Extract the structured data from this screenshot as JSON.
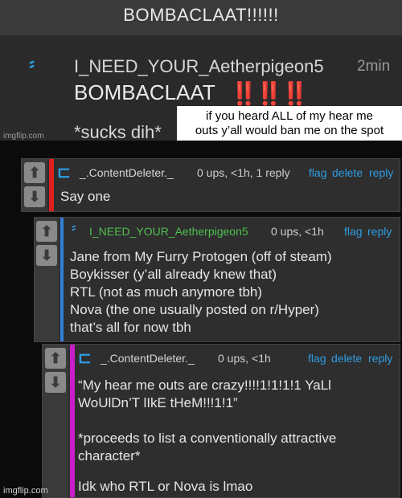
{
  "top_image": {
    "title": "BOMBACLAAT!!!!!!",
    "username": "I_NEED_YOUR_Aetherpigeon5",
    "time": "2min",
    "comment": "BOMBACLAAT",
    "bangs": "‼️‼️‼️",
    "sucks_text": "*sucks dih*",
    "caption_line_1": "if you heard ALL of my hear me",
    "caption_line_2": "outs y’all would ban me on the spot",
    "watermark": "imgflip.com"
  },
  "comments": [
    {
      "username": "_.ContentDeleter._",
      "meta": "0 ups, <1h, 1 reply",
      "actions": [
        "flag",
        "delete",
        "reply"
      ],
      "lines": [
        "Say one"
      ],
      "stripe_color": "#e02020"
    },
    {
      "username": "I_NEED_YOUR_Aetherpigeon5",
      "meta": "0 ups, <1h",
      "actions": [
        "flag",
        "reply"
      ],
      "lines": [
        "Jane from My Furry Protogen (off of steam)",
        "Boykisser (y’all already knew that)",
        "RTL (not as much anymore tbh)",
        "Nova (the one usually posted on r/Hyper)",
        "that’s all for now tbh"
      ],
      "stripe_color": "#2f7fd6"
    },
    {
      "username": "_.ContentDeleter._",
      "meta": "0 ups, <1h",
      "actions": [
        "flag",
        "delete",
        "reply"
      ],
      "lines": [
        "“My hear me outs are crazy!!!!1!1!1!1 YaLl",
        "WoUlDn’T lIkE tHeM!!!1!1”",
        "",
        "*proceeds to list a conventionally attractive",
        "character*",
        "",
        "Idk who RTL or Nova is lmao"
      ],
      "stripe_color": "#c81ec8"
    }
  ],
  "icons": {
    "upvote": "up-arrow-icon",
    "downvote": "down-arrow-icon",
    "user": "user-logo-icon"
  },
  "watermark_bottom": "imgflip.com",
  "colors": {
    "link": "#2f9be0",
    "username_green": "#4fbf4f",
    "bangs_red": "#e01c1c"
  }
}
